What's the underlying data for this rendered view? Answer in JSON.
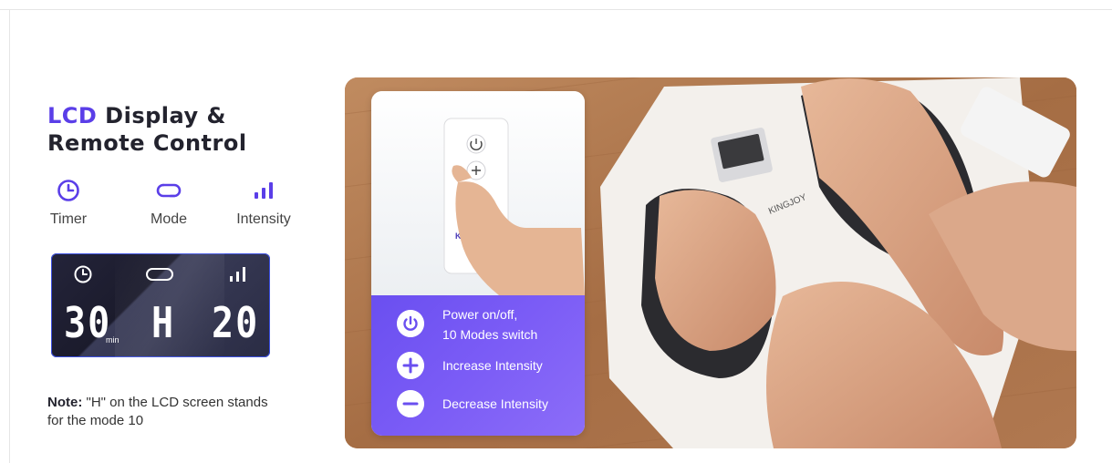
{
  "title": {
    "accent": "LCD",
    "rest_line1": " Display &",
    "line2": "Remote Control"
  },
  "features": [
    {
      "icon": "clock-icon",
      "label": "Timer"
    },
    {
      "icon": "mode-loop-icon",
      "label": "Mode"
    },
    {
      "icon": "intensity-bars-icon",
      "label": "Intensity"
    }
  ],
  "lcd": {
    "timer": "30",
    "unit": "min",
    "mode": "H",
    "intensity": "20"
  },
  "note": {
    "label": "Note:",
    "text": " \"H\" on the LCD screen stands for the mode 10"
  },
  "remote": {
    "brand": "KINGJOY",
    "legend": [
      {
        "icon": "power-icon",
        "lines": [
          "Power on/off,",
          "10 Modes switch"
        ]
      },
      {
        "icon": "plus-icon",
        "lines": [
          "Increase Intensity"
        ]
      },
      {
        "icon": "minus-icon",
        "lines": [
          "Decrease Intensity"
        ]
      }
    ]
  },
  "device": {
    "brand": "KINGJOY"
  },
  "colors": {
    "accent": "#5a3ee8",
    "lcd_bg": "#1f1f30",
    "panel_purple": "#7458f4"
  }
}
